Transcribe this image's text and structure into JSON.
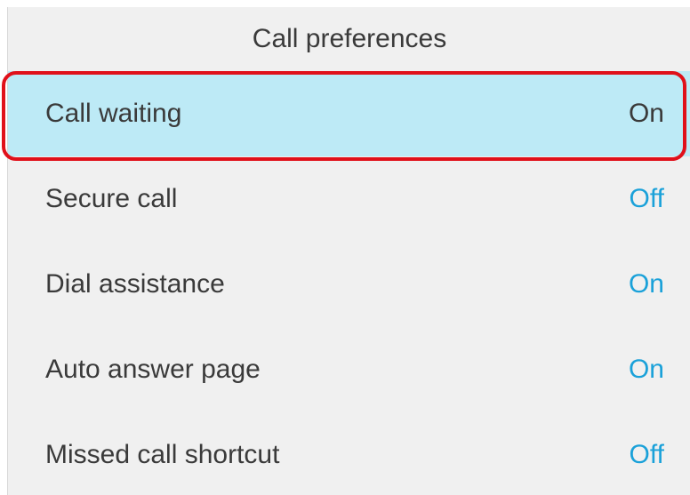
{
  "header": {
    "title": "Call preferences"
  },
  "items": [
    {
      "label": "Call waiting",
      "value": "On"
    },
    {
      "label": "Secure call",
      "value": "Off"
    },
    {
      "label": "Dial assistance",
      "value": "On"
    },
    {
      "label": "Auto answer page",
      "value": "On"
    },
    {
      "label": "Missed call shortcut",
      "value": "Off"
    }
  ],
  "colors": {
    "selected_row_bg": "#bdeaf6",
    "value_accent": "#1aa1d9",
    "highlight_ring": "#e0101a"
  }
}
